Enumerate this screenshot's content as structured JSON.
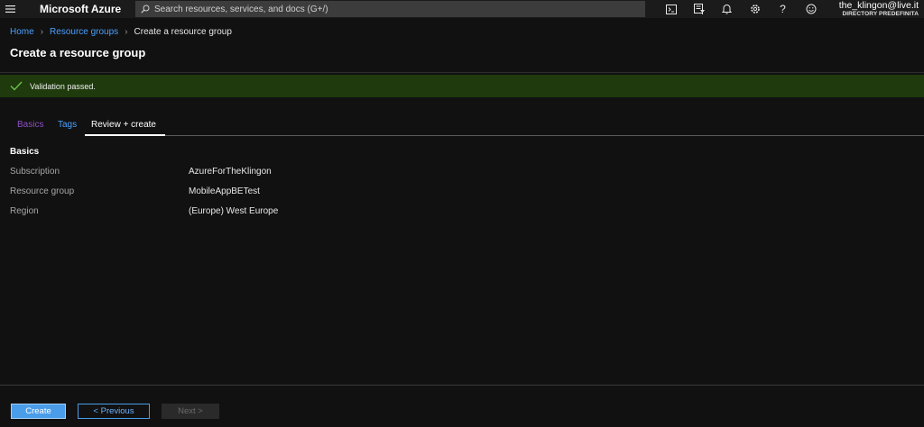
{
  "topbar": {
    "brand": "Microsoft Azure",
    "search_placeholder": "Search resources, services, and docs (G+/)",
    "icons": [
      "terminal-icon",
      "filter-icon",
      "bell-icon",
      "gear-icon",
      "help-icon",
      "smiley-icon"
    ],
    "help_glyph": "?",
    "account_user": "the_klingon@live.it",
    "account_directory": "DIRECTORY PREDEFINITA"
  },
  "breadcrumb": {
    "items": [
      "Home",
      "Resource groups",
      "Create a resource group"
    ]
  },
  "page_title": "Create a resource group",
  "banner": {
    "text": "Validation passed.",
    "color": "#1f3b0d"
  },
  "tabs": [
    {
      "label": "Basics"
    },
    {
      "label": "Tags"
    },
    {
      "label": "Review + create",
      "active": true
    }
  ],
  "summary": {
    "heading": "Basics",
    "rows": [
      {
        "label": "Subscription",
        "value": "AzureForTheKlingon"
      },
      {
        "label": "Resource group",
        "value": "MobileAppBETest"
      },
      {
        "label": "Region",
        "value": "(Europe) West Europe"
      }
    ]
  },
  "footer": {
    "create_label": "Create",
    "previous_label": "< Previous",
    "next_label": "Next >"
  },
  "colors": {
    "accent": "#4a9de9",
    "link": "#4aa0ff",
    "success": "#1f3b0d"
  }
}
